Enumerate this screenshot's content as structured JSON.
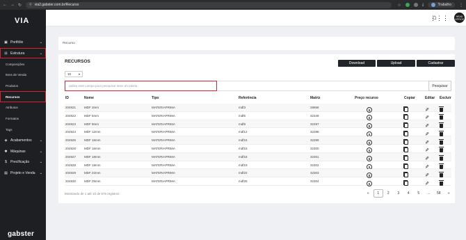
{
  "browser": {
    "url": "via2.gabster.com.br/Recurso",
    "profile_label": "Trabalho"
  },
  "sidebar": {
    "logo": "VIA",
    "brand": "gabster",
    "items": [
      {
        "label": "Portfólio",
        "icon": "portfolio-icon",
        "chevron": true
      },
      {
        "label": "Estrutura",
        "icon": "structure-icon",
        "chevron": true,
        "highlighted": true
      },
      {
        "label": "Composições",
        "sub": true
      },
      {
        "label": "Itens de Venda",
        "sub": true
      },
      {
        "label": "Produtos",
        "sub": true
      },
      {
        "label": "Recursos",
        "sub": true,
        "highlighted": true,
        "active": true
      },
      {
        "label": "Atributos",
        "sub": true
      },
      {
        "label": "Formatos",
        "sub": true
      },
      {
        "label": "Tags",
        "sub": true
      },
      {
        "label": "Acabamentos",
        "icon": "layers-icon",
        "chevron": true
      },
      {
        "label": "Máquinas",
        "icon": "gear-icon",
        "chevron": true
      },
      {
        "label": "Precificação",
        "icon": "dollar-icon",
        "chevron": true
      },
      {
        "label": "Projeto e Venda",
        "icon": "project-icon",
        "chevron": true
      }
    ]
  },
  "header": {
    "avatar_text": "HEAD OFFICE"
  },
  "breadcrumb": "Recurso",
  "main": {
    "title": "RECURSOS",
    "buttons": {
      "download": "Download",
      "upload": "Upload",
      "create": "Cadastrar"
    },
    "per_page": "10",
    "search_placeholder": "Utilize este campo para pesquisar itens da tabela",
    "search_button": "Pesquisar",
    "columns": [
      "ID",
      "Nome",
      "Tipo",
      "Referência",
      "Matriz",
      "Preço recurso",
      "Copiar",
      "Editar",
      "Excluir"
    ],
    "rows": [
      {
        "id": "204921",
        "name": "MDF 3mm",
        "tipo": "MATERIAPRIMA",
        "ref": "mdf3",
        "matriz": "28658"
      },
      {
        "id": "204922",
        "name": "MDF 6mm",
        "tipo": "MATERIAPRIMA",
        "ref": "mdf6",
        "matriz": "32349"
      },
      {
        "id": "204923",
        "name": "MDF 9mm",
        "tipo": "MATERIAPRIMA",
        "ref": "mdf9",
        "matriz": "32297"
      },
      {
        "id": "204924",
        "name": "MDF 12mm",
        "tipo": "MATERIAPRIMA",
        "ref": "mdf12",
        "matriz": "32298"
      },
      {
        "id": "204925",
        "name": "MDF 15mm",
        "tipo": "MATERIAPRIMA",
        "ref": "mdf15",
        "matriz": "32299"
      },
      {
        "id": "204926",
        "name": "MDF 16mm",
        "tipo": "MATERIAPRIMA",
        "ref": "mdf16",
        "matriz": "32300"
      },
      {
        "id": "204927",
        "name": "MDF 18mm",
        "tipo": "MATERIAPRIMA",
        "ref": "mdf18",
        "matriz": "32301"
      },
      {
        "id": "204928",
        "name": "MDF 19mm",
        "tipo": "MATERIAPRIMA",
        "ref": "mdf19",
        "matriz": "32302"
      },
      {
        "id": "204929",
        "name": "MDF 22mm",
        "tipo": "MATERIAPRIMA",
        "ref": "mdf22",
        "matriz": "32303"
      },
      {
        "id": "204930",
        "name": "MDF 25mm",
        "tipo": "MATERIAPRIMA",
        "ref": "mdf25",
        "matriz": "32304"
      }
    ],
    "footer_info": "Mostrando de 1 até 10 de 576 registros",
    "pagination": [
      "«",
      "1",
      "2",
      "3",
      "4",
      "5",
      "...",
      "58",
      "»"
    ],
    "current_page": "1"
  },
  "colors": {
    "highlight": "#d9232e",
    "sidebar_bg": "#1d1f23",
    "button_bg": "#212428"
  }
}
